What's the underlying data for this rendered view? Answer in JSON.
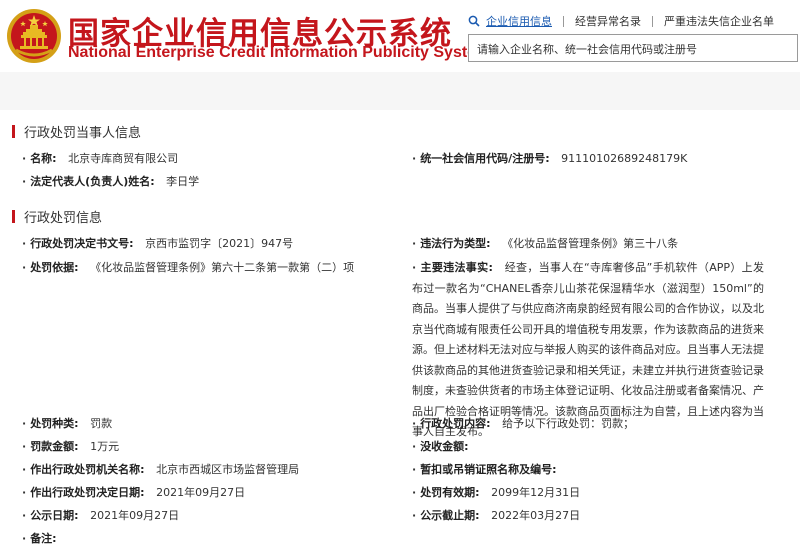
{
  "site": {
    "title": "国家企业信用信息公示系统",
    "subtitle": "National Enterprise Credit Information Publicity System"
  },
  "nav": {
    "items": [
      {
        "label": "企业信用信息",
        "active": true,
        "icon": "search-icon"
      },
      {
        "label": "经营异常名录",
        "active": false
      },
      {
        "label": "严重违法失信企业名单",
        "active": false
      }
    ]
  },
  "search": {
    "placeholder": "请输入企业名称、统一社会信用代码或注册号"
  },
  "colors": {
    "brand_red": "#c4161c",
    "link_blue": "#1a5ab0"
  },
  "party_section": {
    "title": "行政处罚当事人信息",
    "name_label": "名称:",
    "name_value": "北京寺库商贸有限公司",
    "credit_code_label": "统一社会信用代码/注册号:",
    "credit_code_value": "91110102689248179K",
    "legal_rep_label": "法定代表人(负责人)姓名:",
    "legal_rep_value": "李日学"
  },
  "penalty_section": {
    "title": "行政处罚信息",
    "decision_no_label": "行政处罚决定书文号:",
    "decision_no_value": "京西市监罚字〔2021〕947号",
    "violation_type_label": "违法行为类型:",
    "violation_type_value": "《化妆品监督管理条例》第三十八条",
    "basis_label": "处罚依据:",
    "basis_value": "《化妆品监督管理条例》第六十二条第一款第（二）项",
    "main_facts_label": "主要违法事实:",
    "main_facts_value": "经查，当事人在“寺库奢侈品”手机软件（APP）上发布过一款名为“CHANEL香奈儿山茶花保湿精华水（滋润型）150ml”的商品。当事人提供了与供应商济南泉韵经贸有限公司的合作协议，以及北京当代商城有限责任公司开具的增值税专用发票，作为该款商品的进货来源。但上述材料无法对应与举报人购买的该件商品对应。且当事人无法提供该款商品的其他进货查验记录和相关凭证，未建立并执行进货查验记录制度，未查验供货者的市场主体登记证明、化妆品注册或者备案情况、产品出厂检验合格证明等情况。该款商品页面标注为自营，且上述内容为当事人自主发布。",
    "kind_label": "处罚种类:",
    "kind_value": "罚款",
    "content_label": "行政处罚内容:",
    "content_value": "给予以下行政处罚：罚款；",
    "amount_label": "罚款金额:",
    "amount_value": "1万元",
    "confiscation_label": "没收金额:",
    "confiscation_value": "",
    "authority_label": "作出行政处罚机关名称:",
    "authority_value": "北京市西城区市场监督管理局",
    "license_label": "暂扣或吊销证照名称及编号:",
    "license_value": "",
    "decision_date_label": "作出行政处罚决定日期:",
    "decision_date_value": "2021年09月27日",
    "valid_until_label": "处罚有效期:",
    "valid_until_value": "2099年12月31日",
    "publish_date_label": "公示日期:",
    "publish_date_value": "2021年09月27日",
    "publish_end_label": "公示截止期:",
    "publish_end_value": "2022年03月27日",
    "remarks_label": "备注:",
    "remarks_value": ""
  }
}
